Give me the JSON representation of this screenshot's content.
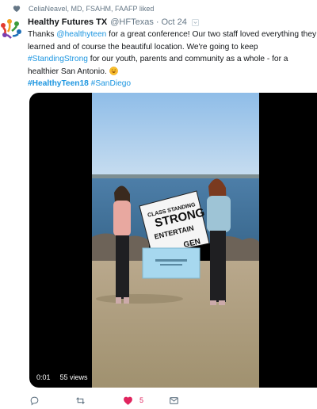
{
  "social_context": {
    "text": "CeliaNeavel, MD, FSAHM, FAAFP liked",
    "icon": "heart-icon"
  },
  "tweet": {
    "author_name": "Healthy Futures TX",
    "handle": "@HFTexas",
    "separator": "·",
    "date": "Oct 24",
    "text": {
      "l1_a": "Thanks ",
      "l1_mention": "@healthyteen",
      "l1_b": " for a great conference! Our two staff loved everything they",
      "l2": "learned and of course the beautiful location. We're going to keep",
      "l3_hashtag": "#StandingStrong",
      "l3_b": " for our youth, parents and community as a whole - for a",
      "l4": "healthier San Antonio.",
      "l5_hashtag1": "#HealthyTeen18",
      "l5_space": " ",
      "l5_hashtag2": "#SanDiego"
    }
  },
  "video": {
    "elapsed": "0:01",
    "views": "55 views",
    "poster_sign_words": "CLASS STANDING STRONG ENTERTAIN GEN"
  },
  "actions": {
    "like_count": "5",
    "icons": [
      "reply-icon",
      "retweet-icon",
      "like-heart-icon",
      "direct-message-icon"
    ]
  },
  "colors": {
    "link": "#1b95e0",
    "muted": "#657786",
    "like": "#e0245e",
    "video_bg": "#000000"
  }
}
